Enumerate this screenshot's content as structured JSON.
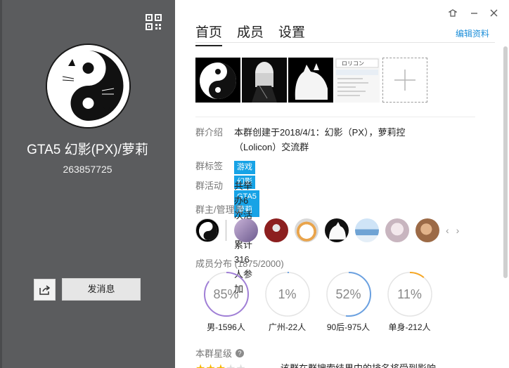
{
  "left": {
    "group_name": "GTA5 幻影(PX)/萝莉",
    "group_id": "263857725",
    "send_message_label": "发消息",
    "icons": {
      "qr": "qrcode-icon",
      "share": "share-icon"
    }
  },
  "window_controls": {
    "skin": "skin-icon",
    "minimize": "minimize-icon",
    "close": "close-icon"
  },
  "tabs": [
    {
      "label": "首页",
      "active": true
    },
    {
      "label": "成员",
      "active": false
    },
    {
      "label": "设置",
      "active": false
    }
  ],
  "edit_link": "编辑资料",
  "info": {
    "intro_label": "群介绍",
    "intro_text_1": "本群创建于2018/4/1：幻影（PX），萝莉控",
    "intro_text_2": "（Lolicon）交流群",
    "tags_label": "群标签",
    "tags": [
      "游戏",
      "幻影",
      "GTA5",
      "萝莉控"
    ],
    "activity_label": "群活动",
    "activity_text": "共举办6次活动，累计316人参加"
  },
  "admins_title": "群主/管理员",
  "distribution_title": "成员分布 (1875/2000)",
  "stats": [
    {
      "pct": "85%",
      "value": 0.85,
      "caption": "男-1596人",
      "color": "#a07fd6"
    },
    {
      "pct": "1%",
      "value": 0.01,
      "caption": "广州-22人",
      "color": "#6aa0e0"
    },
    {
      "pct": "52%",
      "value": 0.52,
      "caption": "90后-975人",
      "color": "#6aa0e0"
    },
    {
      "pct": "11%",
      "value": 0.11,
      "caption": "单身-212人",
      "color": "#f5a623"
    }
  ],
  "level_title": "本群星级",
  "level_text_partial": "该群在群搜索结果中的排名将受到影响"
}
